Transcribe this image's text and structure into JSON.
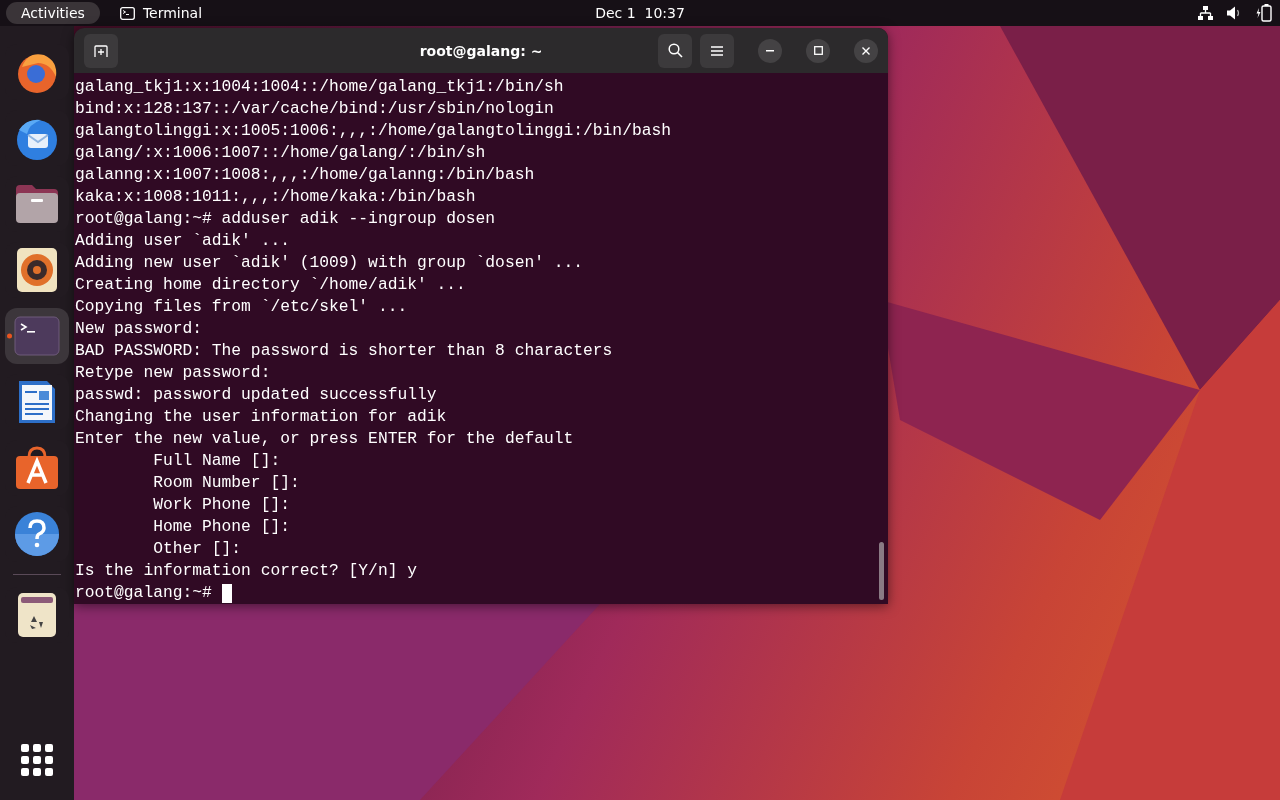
{
  "top_bar": {
    "activities": "Activities",
    "app_name": "Terminal",
    "clock": "Dec 1  10:37"
  },
  "dock": {
    "items": [
      {
        "kind": "firefox",
        "active": false
      },
      {
        "kind": "thunderbird",
        "active": false
      },
      {
        "kind": "files",
        "active": false
      },
      {
        "kind": "rhythmbox",
        "active": false
      },
      {
        "kind": "terminal",
        "active": true
      },
      {
        "kind": "writer",
        "active": false
      },
      {
        "kind": "appcenter",
        "active": false
      },
      {
        "kind": "help",
        "active": false
      },
      {
        "kind": "separator"
      },
      {
        "kind": "trash",
        "active": false
      }
    ]
  },
  "window": {
    "title": "root@galang: ~",
    "lines": [
      "galang_tkj1:x:1004:1004::/home/galang_tkj1:/bin/sh",
      "bind:x:128:137::/var/cache/bind:/usr/sbin/nologin",
      "galangtolinggi:x:1005:1006:,,,:/home/galangtolinggi:/bin/bash",
      "galang/:x:1006:1007::/home/galang/:/bin/sh",
      "galanng:x:1007:1008:,,,:/home/galanng:/bin/bash",
      "kaka:x:1008:1011:,,,:/home/kaka:/bin/bash",
      "root@galang:~# adduser adik --ingroup dosen",
      "Adding user `adik' ...",
      "Adding new user `adik' (1009) with group `dosen' ...",
      "Creating home directory `/home/adik' ...",
      "Copying files from `/etc/skel' ...",
      "New password:",
      "BAD PASSWORD: The password is shorter than 8 characters",
      "Retype new password:",
      "passwd: password updated successfully",
      "Changing the user information for adik",
      "Enter the new value, or press ENTER for the default",
      "        Full Name []:",
      "        Room Number []:",
      "        Work Phone []:",
      "        Home Phone []:",
      "        Other []:",
      "Is the information correct? [Y/n] y"
    ],
    "prompt": "root@galang:~# "
  }
}
